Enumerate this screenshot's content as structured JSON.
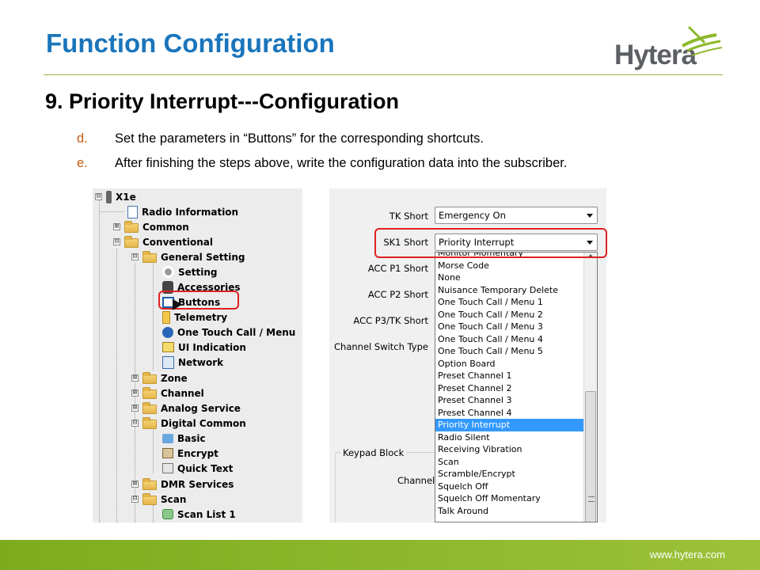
{
  "slide": {
    "title": "Function Configuration",
    "logo_text": "Hytera",
    "section_title": "9. Priority Interrupt---Configuration",
    "bullets": [
      {
        "mark": "d.",
        "text": "Set the parameters in “Buttons” for the corresponding shortcuts."
      },
      {
        "mark": "e.",
        "text": "After finishing the steps above, write the configuration data into the subscriber."
      }
    ],
    "footer_url": "www.hytera.com"
  },
  "tree": {
    "items": [
      {
        "label": "X1e",
        "icon": "radio-icon",
        "expander": "⊟"
      },
      {
        "label": "Radio Information",
        "icon": "document-icon",
        "expander": ""
      },
      {
        "label": "Common",
        "icon": "folder-icon",
        "expander": "⊞"
      },
      {
        "label": "Conventional",
        "icon": "folder-open-icon",
        "expander": "⊟"
      },
      {
        "label": "General Setting",
        "icon": "folder-open-icon",
        "expander": "⊟"
      },
      {
        "label": "Setting",
        "icon": "wrench-icon",
        "expander": ""
      },
      {
        "label": "Accessories",
        "icon": "accessories-icon",
        "expander": ""
      },
      {
        "label": "Buttons",
        "icon": "buttons-icon",
        "expander": ""
      },
      {
        "label": "Telemetry",
        "icon": "telemetry-icon",
        "expander": ""
      },
      {
        "label": "One Touch Call / Menu",
        "icon": "one-touch-call-icon",
        "expander": ""
      },
      {
        "label": "UI Indication",
        "icon": "ui-indication-icon",
        "expander": ""
      },
      {
        "label": "Network",
        "icon": "network-icon",
        "expander": ""
      },
      {
        "label": "Zone",
        "icon": "folder-icon",
        "expander": "⊞"
      },
      {
        "label": "Channel",
        "icon": "folder-icon",
        "expander": "⊞"
      },
      {
        "label": "Analog Service",
        "icon": "folder-icon",
        "expander": "⊞"
      },
      {
        "label": "Digital Common",
        "icon": "folder-open-icon",
        "expander": "⊟"
      },
      {
        "label": "Basic",
        "icon": "basic-icon",
        "expander": ""
      },
      {
        "label": "Encrypt",
        "icon": "encrypt-icon",
        "expander": ""
      },
      {
        "label": "Quick Text",
        "icon": "quick-text-icon",
        "expander": ""
      },
      {
        "label": "DMR Services",
        "icon": "folder-icon",
        "expander": "⊞"
      },
      {
        "label": "Scan",
        "icon": "folder-open-icon",
        "expander": "⊟"
      },
      {
        "label": "Scan List 1",
        "icon": "scan-list-icon",
        "expander": ""
      }
    ]
  },
  "config": {
    "labels": {
      "tk_short": "TK Short",
      "sk1_short": "SK1 Short",
      "acc_p1_short": "ACC P1 Short",
      "acc_p2_short": "ACC P2 Short",
      "acc_p3_tk_short": "ACC P3/TK Short",
      "channel_switch_type": "Channel Switch Type",
      "keypad_block": "Keypad Block",
      "channel_cut": "Channel/"
    },
    "tk_short_value": "Emergency On",
    "sk1_short_value": "Priority Interrupt",
    "dropdown_options": [
      "Monitor Momentary",
      "Morse Code",
      "None",
      "Nuisance Temporary Delete",
      "One Touch Call / Menu 1",
      "One Touch Call / Menu 2",
      "One Touch Call / Menu 3",
      "One Touch Call / Menu 4",
      "One Touch Call / Menu 5",
      "Option Board",
      "Preset Channel 1",
      "Preset Channel 2",
      "Preset Channel 3",
      "Preset Channel 4",
      "Priority Interrupt",
      "Radio Silent",
      "Receiving Vibration",
      "Scan",
      "Scramble/Encrypt",
      "Squelch Off",
      "Squelch Off Momentary",
      "Talk Around"
    ],
    "selected_option": "Priority Interrupt"
  },
  "colors": {
    "title_blue": "#1a75bb",
    "accent_green": "#8cb82b",
    "highlight_red": "#e02020",
    "selection_blue": "#3399ff"
  }
}
